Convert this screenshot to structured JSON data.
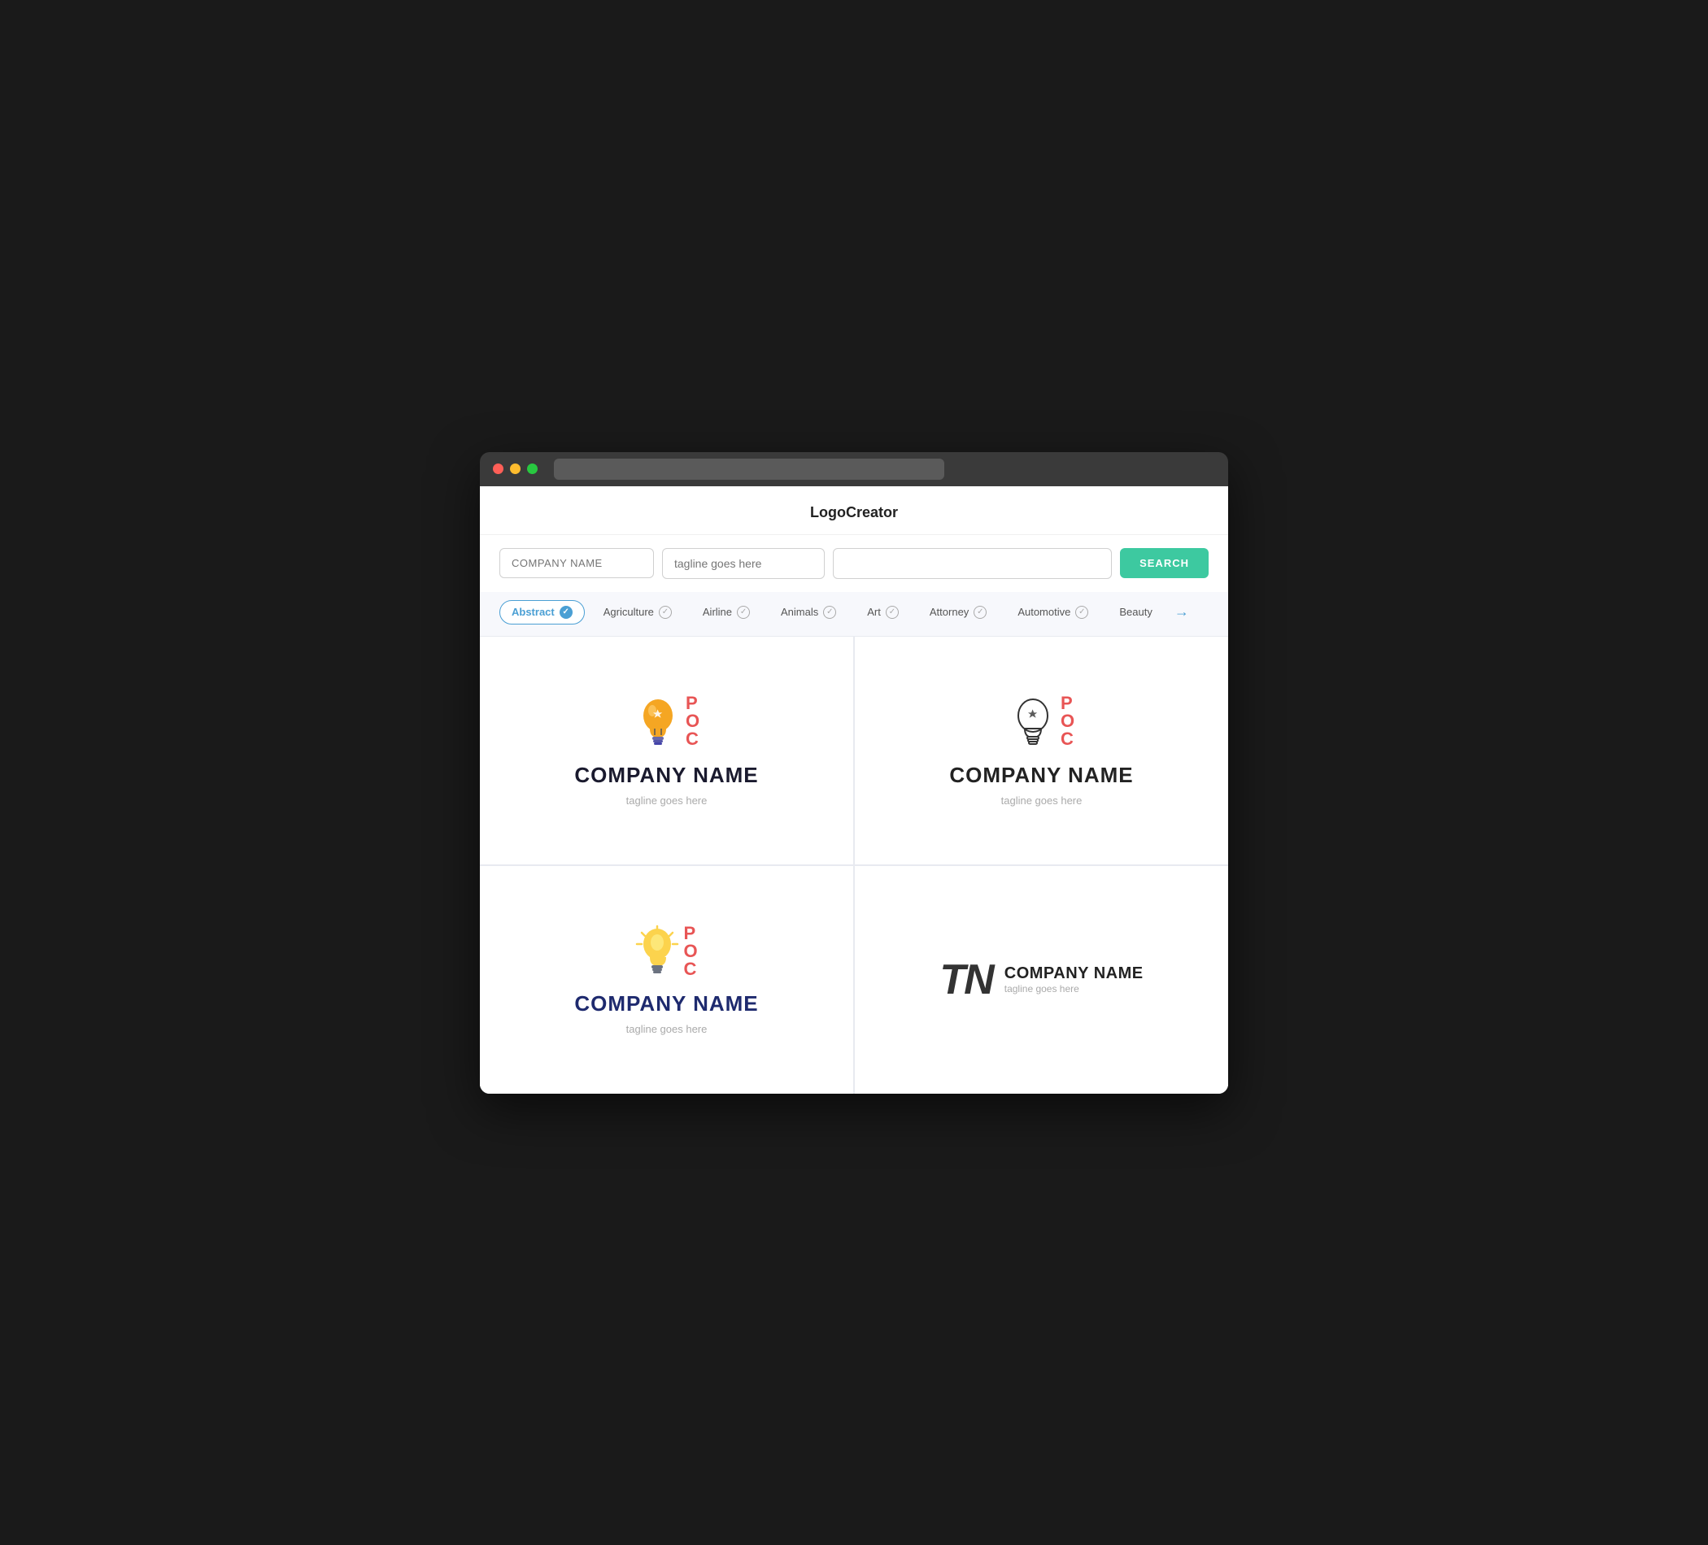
{
  "app": {
    "title": "LogoCreator"
  },
  "search": {
    "company_placeholder": "COMPANY NAME",
    "tagline_placeholder": "tagline goes here",
    "extra_placeholder": "",
    "search_button_label": "SEARCH"
  },
  "categories": [
    {
      "id": "abstract",
      "label": "Abstract",
      "active": true
    },
    {
      "id": "agriculture",
      "label": "Agriculture",
      "active": false
    },
    {
      "id": "airline",
      "label": "Airline",
      "active": false
    },
    {
      "id": "animals",
      "label": "Animals",
      "active": false
    },
    {
      "id": "art",
      "label": "Art",
      "active": false
    },
    {
      "id": "attorney",
      "label": "Attorney",
      "active": false
    },
    {
      "id": "automotive",
      "label": "Automotive",
      "active": false
    },
    {
      "id": "beauty",
      "label": "Beauty",
      "active": false
    }
  ],
  "logos": [
    {
      "id": "logo1",
      "type": "colored-bulb",
      "company_name": "COMPANY NAME",
      "tagline": "tagline goes here"
    },
    {
      "id": "logo2",
      "type": "outline-bulb",
      "company_name": "COMPANY NAME",
      "tagline": "tagline goes here"
    },
    {
      "id": "logo3",
      "type": "yellow-bulb",
      "company_name": "COMPANY NAME",
      "tagline": "tagline goes here"
    },
    {
      "id": "logo4",
      "type": "tn-monogram",
      "company_name": "COMPANY NAME",
      "tagline": "tagline goes here"
    }
  ],
  "colors": {
    "search_btn": "#3dc9a0",
    "active_category_border": "#4a9fd4",
    "active_category_text": "#4a9fd4"
  }
}
